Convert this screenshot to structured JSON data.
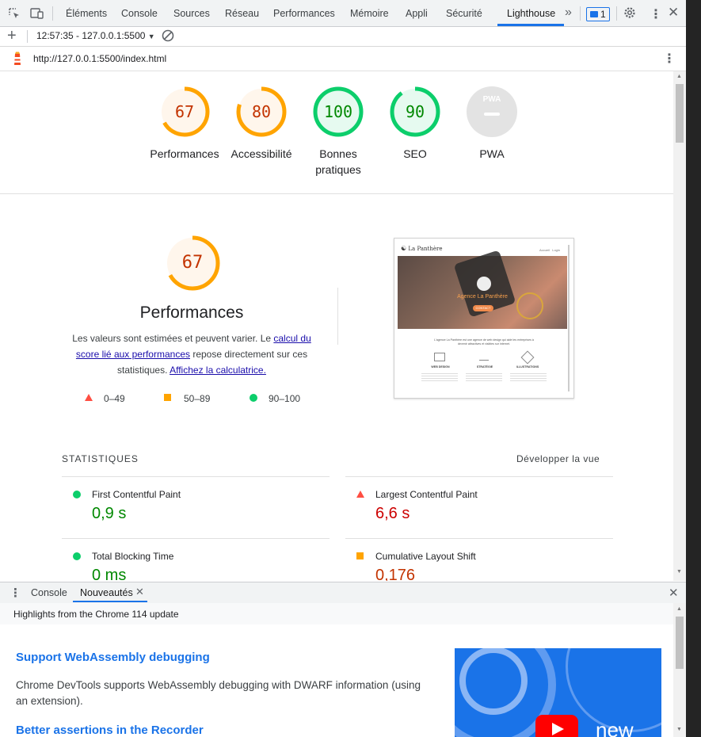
{
  "devtools_tabs": [
    "Éléments",
    "Console",
    "Sources",
    "Réseau",
    "Performances",
    "Mémoire",
    "Appli",
    "Sécurité",
    "Lighthouse"
  ],
  "active_tab": "Lighthouse",
  "issues_count": "1",
  "report_selector": "12:57:35 - 127.0.0.1:5500",
  "page_url": "http://127.0.0.1:5500/index.html",
  "scores": [
    {
      "value": "67",
      "label": "Performances",
      "color": "#ffa400",
      "fraction": 0.67
    },
    {
      "value": "80",
      "label": "Accessibilité",
      "color": "#ffa400",
      "fraction": 0.8
    },
    {
      "value": "100",
      "label": "Bonnes pratiques",
      "color": "#0cce6b",
      "fraction": 1.0
    },
    {
      "value": "90",
      "label": "SEO",
      "color": "#0cce6b",
      "fraction": 0.9
    },
    {
      "value": "PWA",
      "label": "PWA",
      "color": "#9aa0a6",
      "fraction": 0
    }
  ],
  "performance": {
    "score": "67",
    "title": "Performances",
    "desc_1": "Les valeurs sont estimées et peuvent varier. Le ",
    "desc_link_1": "calcul du score lié aux performances",
    "desc_2": " repose directement sur ces statistiques. ",
    "desc_link_2": "Affichez la calculatrice.",
    "legend": [
      "0–49",
      "50–89",
      "90–100"
    ]
  },
  "screenshot": {
    "site_name": "La Panthère",
    "nav": "Accueil   Login",
    "hero_title": "Agence La Panthère",
    "hero_button": "CONTACT",
    "intro": "L'agence La Panthère est une agence de web design qui aide les entreprises à devenir attractives et visibles sur internet.",
    "cols": [
      "WEB DESIGN",
      "STRATÉGIE",
      "ILLUSTRATIONS"
    ]
  },
  "stats": {
    "heading": "STATISTIQUES",
    "expand": "Développer la vue",
    "metrics": [
      {
        "label": "First Contentful Paint",
        "value": "0,9 s",
        "status": "pass"
      },
      {
        "label": "Largest Contentful Paint",
        "value": "6,6 s",
        "status": "fail"
      },
      {
        "label": "Total Blocking Time",
        "value": "0 ms",
        "status": "pass"
      },
      {
        "label": "Cumulative Layout Shift",
        "value": "0,176",
        "status": "average"
      }
    ]
  },
  "drawer": {
    "tabs": [
      "Console",
      "Nouveautés"
    ],
    "active": "Nouveautés",
    "subtitle": "Highlights from the Chrome 114 update",
    "h1": "Support WebAssembly debugging",
    "p1": "Chrome DevTools supports WebAssembly debugging with DWARF information (using an extension).",
    "h2": "Better assertions in the Recorder",
    "video_text": "new"
  },
  "colors": {
    "pass": "#0cce6b",
    "average": "#ffa400",
    "fail": "#ff4e42",
    "accent": "#1a73e8"
  }
}
